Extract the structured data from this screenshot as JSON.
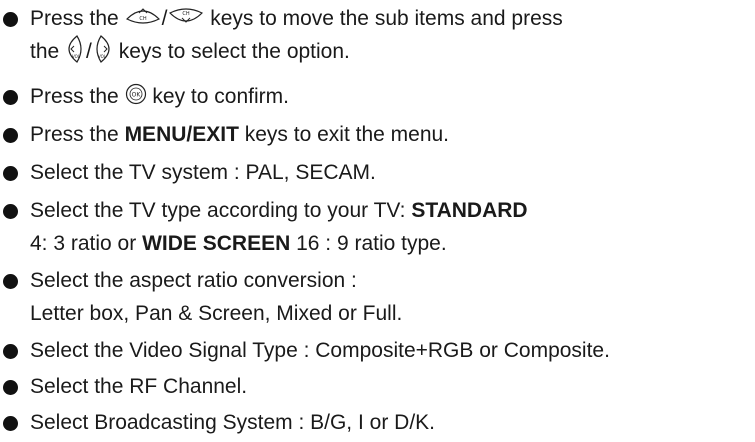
{
  "items": [
    {
      "line1": {
        "pre": "Press the",
        "sep": "/",
        "post": "keys to move the sub items and press"
      },
      "line2": {
        "pre": "the",
        "sep": "/",
        "post": "keys to select the option."
      }
    },
    {
      "pre": "Press the",
      "post": "key to confirm."
    },
    {
      "pre": "Press the",
      "bold": "MENU/EXIT",
      "post": "keys to exit the menu."
    },
    {
      "text": "Select the TV system : PAL, SECAM."
    },
    {
      "line1": {
        "pre": "Select the TV type according to your TV:",
        "bold": "STANDARD"
      },
      "line2": {
        "pre": "4: 3 ratio or",
        "bold": "WIDE SCREEN",
        "post": "16 : 9 ratio type."
      }
    },
    {
      "line1": "Select the aspect ratio conversion :",
      "line2": "Letter box, Pan & Screen, Mixed or Full."
    },
    {
      "text": "Select the Video Signal Type : Composite+RGB or Composite."
    },
    {
      "text": "Select the RF Channel."
    },
    {
      "text": "Select  Broadcasting System : B/G, I or D/K."
    }
  ],
  "icons": {
    "key_up": "channel-up-key-icon",
    "key_down": "channel-down-key-icon",
    "key_left": "volume-left-key-icon",
    "key_right": "volume-right-key-icon",
    "key_ok": "ok-key-icon"
  },
  "key_labels": {
    "up": "CH",
    "down": "CH",
    "left": "VOL",
    "right": "VOL",
    "ok": "OK"
  }
}
